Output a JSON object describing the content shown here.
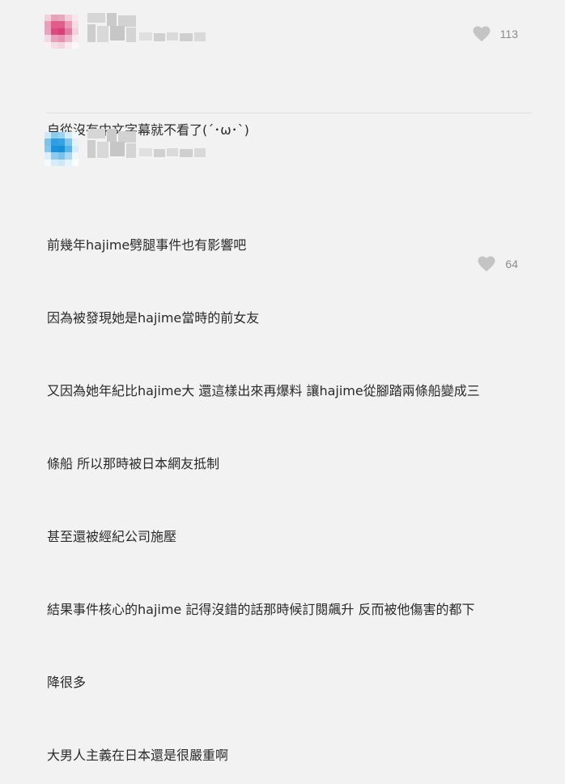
{
  "comments": [
    {
      "likes": "113",
      "avatar_colors": [
        "#f3cfd9",
        "#e7a0b8",
        "#e8a7bc",
        "#f2d0da",
        "#f7e6ec",
        "#eb9eba",
        "#e05c8b",
        "#df5e8c",
        "#e89ab6",
        "#f5dde6",
        "#e9a4bd",
        "#dc4a7f",
        "#d93e77",
        "#e17aa0",
        "#f3d0dc",
        "#f4d9e2",
        "#e7a2bb",
        "#e693b1",
        "#ecb4c7",
        "#f8e8ee",
        "#fbf1f4",
        "#f6dce4",
        "#f4d5df",
        "#f9eaef",
        "#fdf7f9"
      ],
      "lines": [
        "自從沒有中文字幕就不看了(´･ω･`)"
      ],
      "heart_color": "#c4c4c4"
    },
    {
      "likes": "64",
      "avatar_colors": [
        "#cfe8f7",
        "#8ccbee",
        "#9ad2f0",
        "#d4ebf8",
        "#eef7fc",
        "#7cc3ec",
        "#2f9ee0",
        "#35a3e2",
        "#7fc5ec",
        "#e2f1fa",
        "#86c8ed",
        "#1d93dc",
        "#1a8fd9",
        "#5ab3e6",
        "#d6ecf8",
        "#dbeef9",
        "#8fcbee",
        "#7bc2eb",
        "#a9d8f2",
        "#f0f8fc",
        "#f4fafd",
        "#d9edf8",
        "#cfe7f6",
        "#e6f3fa",
        "#fafdfe"
      ],
      "lines": [
        "前幾年hajime劈腿事件也有影響吧",
        "因為被發現她是hajime當時的前女友",
        "又因為她年紀比hajime大 還這樣出來再爆料 讓hajime從腳踏兩條船變成三",
        "條船 所以那時被日本網友抵制",
        "甚至還被經紀公司施壓",
        "結果事件核心的hajime 記得沒錯的話那時候訂閱飆升 反而被他傷害的都下",
        "降很多",
        "大男人主義在日本還是很嚴重啊"
      ],
      "heart_color": "#c4c4c4"
    }
  ]
}
